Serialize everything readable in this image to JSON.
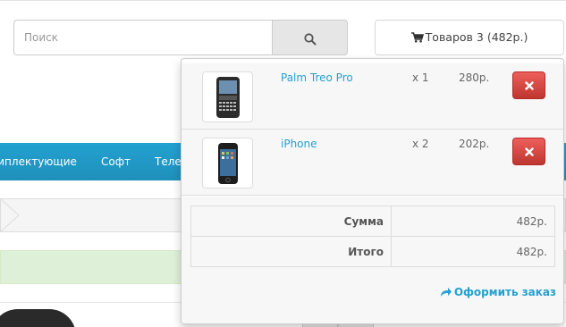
{
  "search": {
    "placeholder": "Поиск"
  },
  "cart": {
    "button_label": "Товаров 3 (482р.)"
  },
  "menu": {
    "items": [
      "мплектующие",
      "Софт",
      "Теле"
    ]
  },
  "dropdown": {
    "items": [
      {
        "name": "Palm Treo Pro",
        "qty": "x 1",
        "price": "280р."
      },
      {
        "name": "iPhone",
        "qty": "x 2",
        "price": "202р."
      }
    ],
    "totals": [
      {
        "label": "Сумма",
        "value": "482р."
      },
      {
        "label": "Итого",
        "value": "482р."
      }
    ],
    "checkout_label": "Оформить заказ"
  },
  "colors": {
    "accent": "#23a1d1",
    "danger": "#da4f49",
    "menu_bg": "#229ac8",
    "alert_bg": "#dff0d8"
  }
}
